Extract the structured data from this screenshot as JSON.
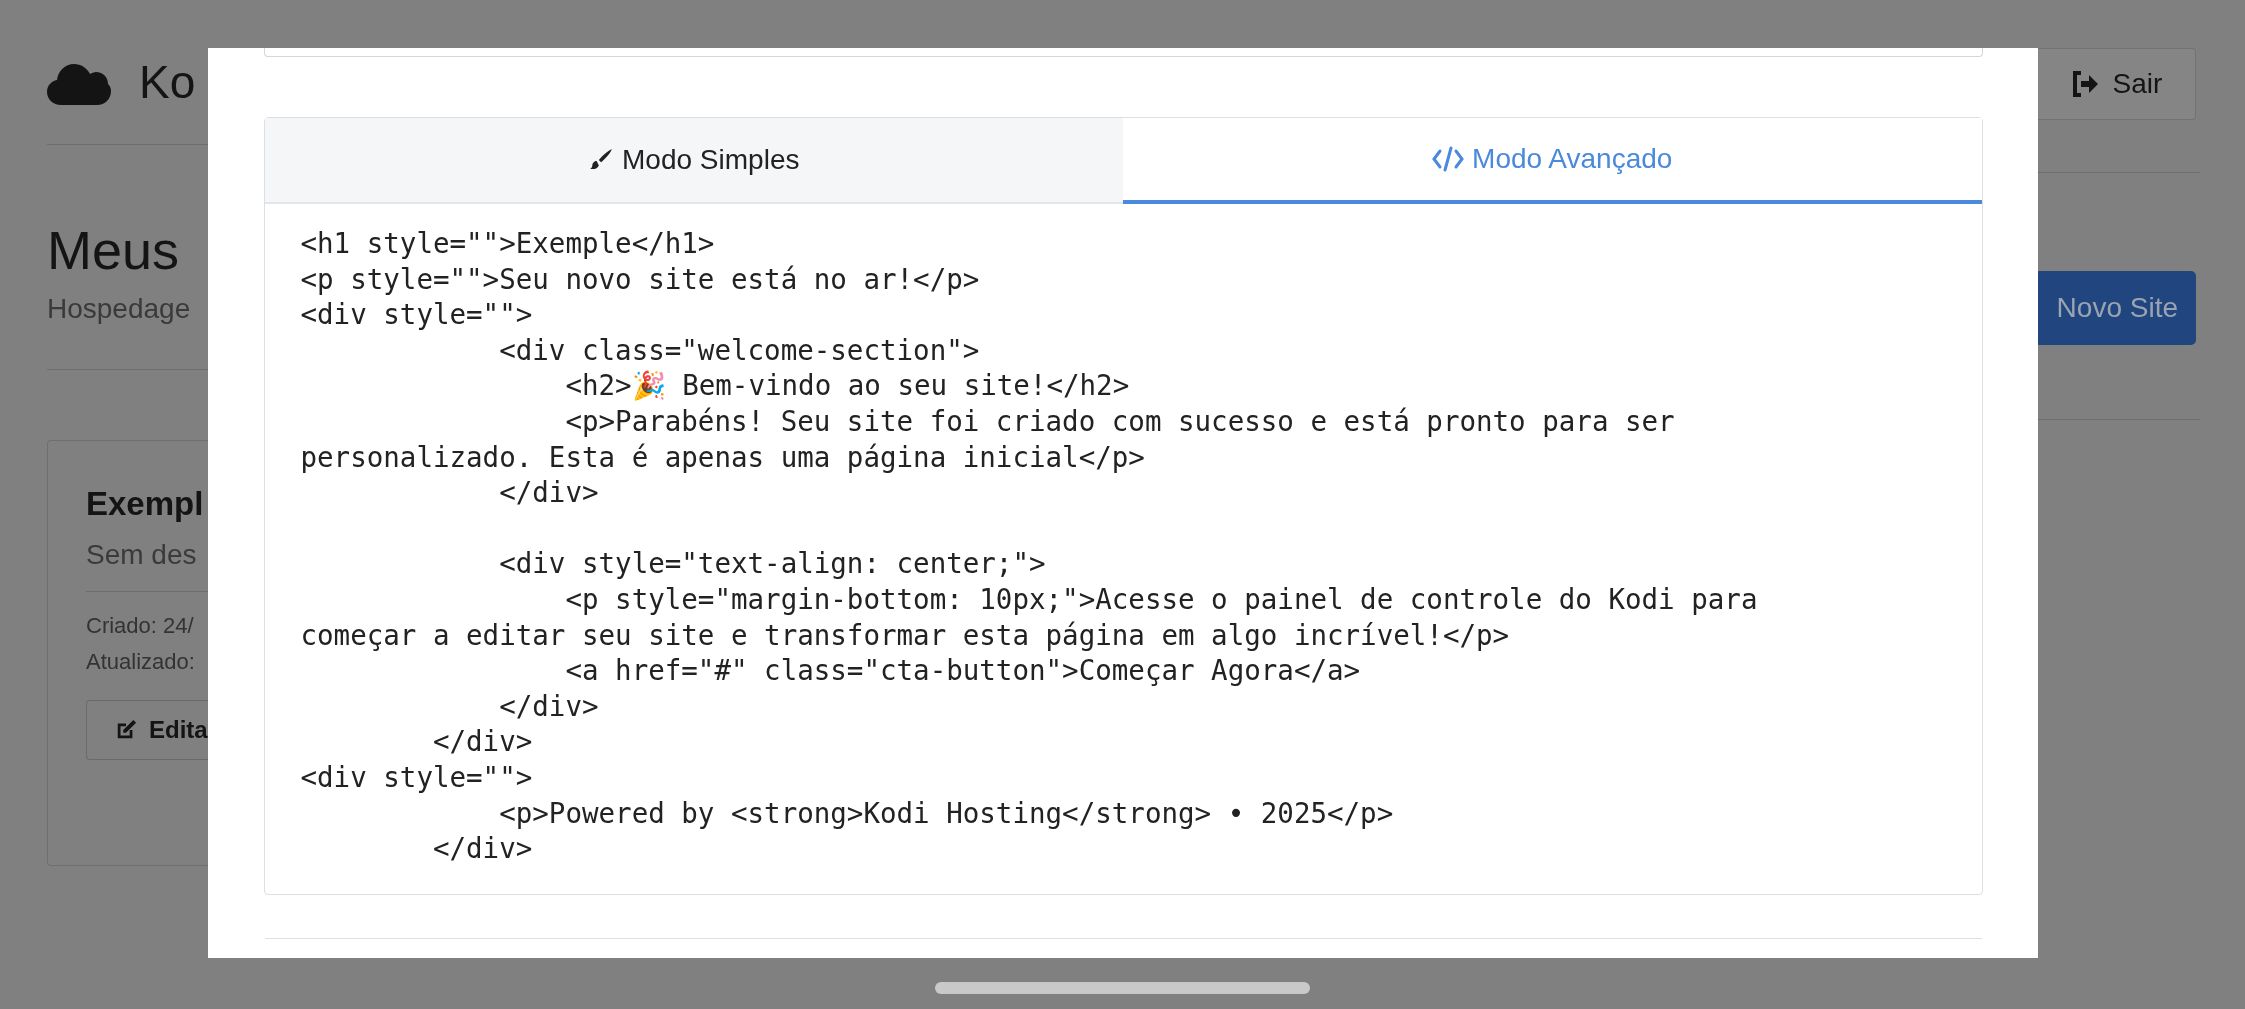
{
  "header": {
    "brand": "Ko",
    "logout_button": "Sair"
  },
  "page": {
    "title": "Meus",
    "subtitle": "Hospedage",
    "new_site_button": "Novo Site"
  },
  "site_card": {
    "name": "Exempl",
    "description": "Sem des",
    "created": "Criado: 24/",
    "updated": "Atualizado:",
    "edit_button": "Edita"
  },
  "modal": {
    "tabs": [
      {
        "label": "Modo Simples",
        "kind": "brush",
        "selected": false
      },
      {
        "label": "Modo Avançado",
        "kind": "code",
        "selected": true
      }
    ],
    "code": "<h1 style=\"\">Exemple</h1>\n<p style=\"\">Seu novo site está no ar!</p>\n<div style=\"\">\n            <div class=\"welcome-section\">\n                <h2>🎉 Bem-vindo ao seu site!</h2>\n                <p>Parabéns! Seu site foi criado com sucesso e está pronto para ser\npersonalizado. Esta é apenas uma página inicial</p>\n            </div>\n\n            <div style=\"text-align: center;\">\n                <p style=\"margin-bottom: 10px;\">Acesse o painel de controle do Kodi para\ncomeçar a editar seu site e transformar esta página em algo incrível!</p>\n                <a href=\"#\" class=\"cta-button\">Começar Agora</a>\n            </div>\n        </div>\n<div style=\"\">\n            <p>Powered by <strong>Kodi Hosting</strong> • 2025</p>\n        </div>"
  }
}
